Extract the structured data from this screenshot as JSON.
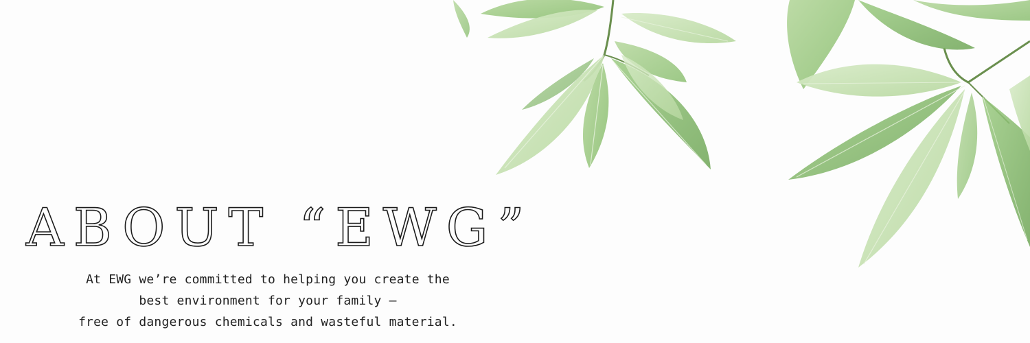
{
  "banner": {
    "title": "ABOUT “EWG”",
    "tagline_lines": [
      "At EWG we’re committed to helping you create the",
      "best environment for your family —",
      "free of dangerous chemicals and wasteful material."
    ]
  },
  "colors": {
    "background": "#fdfdfd",
    "text": "#1b1b1b",
    "leaf_light": "#c9e2b6",
    "leaf_mid": "#a8d08f",
    "leaf_dark": "#7fb465",
    "stem": "#6a8f4e"
  }
}
